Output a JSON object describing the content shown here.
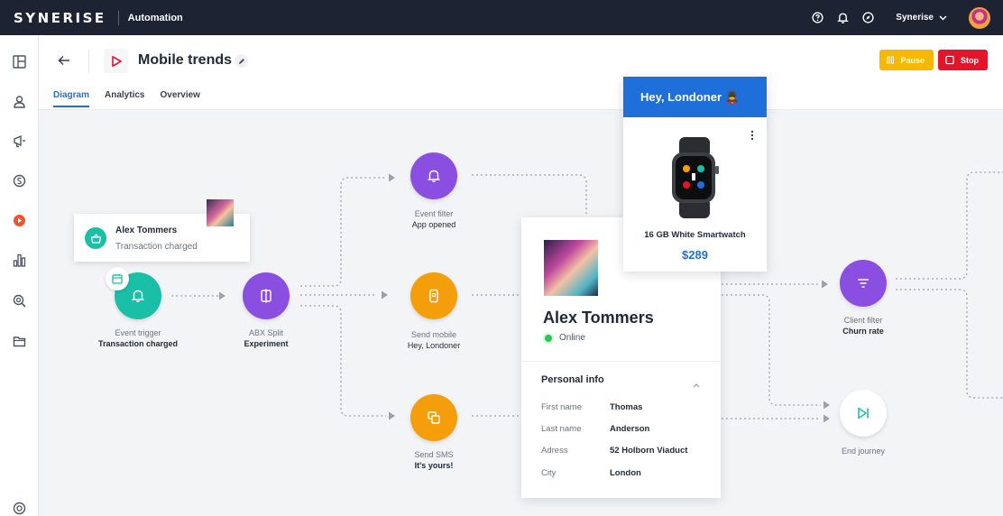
{
  "topbar": {
    "logo": "SYNERISE",
    "module": "Automation",
    "account": "Synerise",
    "icons": [
      "help-icon",
      "bell-icon",
      "compass-icon",
      "chevron-down-icon"
    ]
  },
  "sidebar": {
    "items": [
      "dashboard-icon",
      "profile-icon",
      "campaign-icon",
      "currency-icon",
      "automation-icon",
      "analytics-icon",
      "search-data-icon",
      "folder-icon",
      "settings-icon"
    ]
  },
  "header": {
    "title": "Mobile trends",
    "tabs": [
      {
        "label": "Diagram",
        "active": true
      },
      {
        "label": "Analytics",
        "active": false
      },
      {
        "label": "Overview",
        "active": false
      }
    ],
    "pause_label": "Pause",
    "stop_label": "Stop"
  },
  "colors": {
    "accent": "#1f6fdb",
    "teal": "#19bfa6",
    "purple": "#8a4fe0",
    "orange": "#f59e0b",
    "pause": "#f6b800",
    "stop": "#e3152b"
  },
  "nodes": [
    {
      "id": "event-trigger",
      "line1": "Event trigger",
      "line2": "Transaction charged"
    },
    {
      "id": "abx-split",
      "line1": "ABX Split",
      "line2": "Experiment"
    },
    {
      "id": "event-filter",
      "line1": "Event filter",
      "line2": "App opened"
    },
    {
      "id": "send-mobile",
      "line1": "Send mobile",
      "line2": "Hey, Londoner"
    },
    {
      "id": "send-sms",
      "line1": "Send SMS",
      "line2": "It's yours!"
    },
    {
      "id": "client-filter",
      "line1": "Client filter",
      "line2": "Churn rate"
    },
    {
      "id": "end-journey",
      "line1": "End journey",
      "line2": ""
    }
  ],
  "notification": {
    "name": "Alex Tommers",
    "subtitle": "Transaction charged"
  },
  "profile": {
    "name": "Alex Tommers",
    "status": "Online",
    "section_title": "Personal info",
    "fields": [
      {
        "key": "First name",
        "value": "Thomas"
      },
      {
        "key": "Last name",
        "value": "Anderson"
      },
      {
        "key": "Adress",
        "value": "52 Holborn Viaduct"
      },
      {
        "key": "City",
        "value": "London"
      }
    ]
  },
  "product": {
    "header": "Hey, Londoner 💂",
    "name": "16 GB White Smartwatch",
    "price": "$289"
  }
}
